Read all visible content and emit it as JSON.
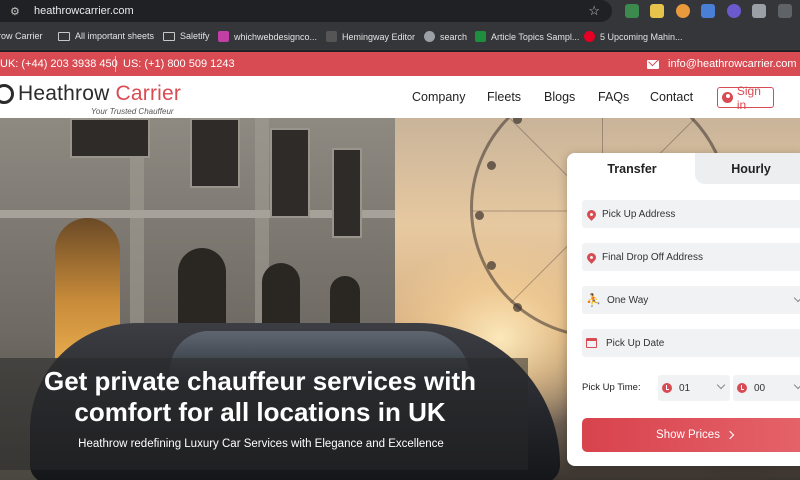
{
  "browser": {
    "url": "heathrowcarrier.com",
    "bookmarks": [
      {
        "label": "row Carrier",
        "icon": "heathrow-favicon-icon"
      },
      {
        "label": "All important sheets",
        "icon": "folder-icon"
      },
      {
        "label": "Saletify",
        "icon": "folder-icon"
      },
      {
        "label": "whichwebdesignco...",
        "icon": "whichweb-favicon-icon"
      },
      {
        "label": "Hemingway Editor",
        "icon": "hemingway-favicon-icon"
      },
      {
        "label": "search",
        "icon": "globe-icon"
      },
      {
        "label": "Article Topics Sampl...",
        "icon": "sheets-favicon-icon"
      },
      {
        "label": "5 Upcoming Mahin...",
        "icon": "pinterest-favicon-icon"
      }
    ]
  },
  "topbar": {
    "uk_phone": "UK: (+44) 203 3938 450",
    "us_phone": "US: (+1) 800 509 1243",
    "email": "info@heathrowcarrier.com",
    "accent_color": "#d84b53"
  },
  "header": {
    "logo_main": "Heathrow",
    "logo_accent": "Carrier",
    "tagline": "Your Trusted Chauffeur",
    "nav": [
      "Company",
      "Fleets",
      "Blogs",
      "FAQs",
      "Contact"
    ],
    "signin": "Sign in"
  },
  "hero": {
    "title_line1": "Get private chauffeur services with",
    "title_line2": "comfort for all locations in UK",
    "subtitle": "Heathrow redefining Luxury Car Services with Elegance and Excellence"
  },
  "booking": {
    "tabs": [
      "Transfer",
      "Hourly"
    ],
    "active_tab": "Transfer",
    "pickup_placeholder": "Pick Up Address",
    "dropoff_placeholder": "Final Drop Off Address",
    "trip_type": "One Way",
    "date_placeholder": "Pick Up Date",
    "time_label": "Pick Up Time:",
    "hour": "01",
    "minute": "00",
    "submit": "Show Prices"
  }
}
